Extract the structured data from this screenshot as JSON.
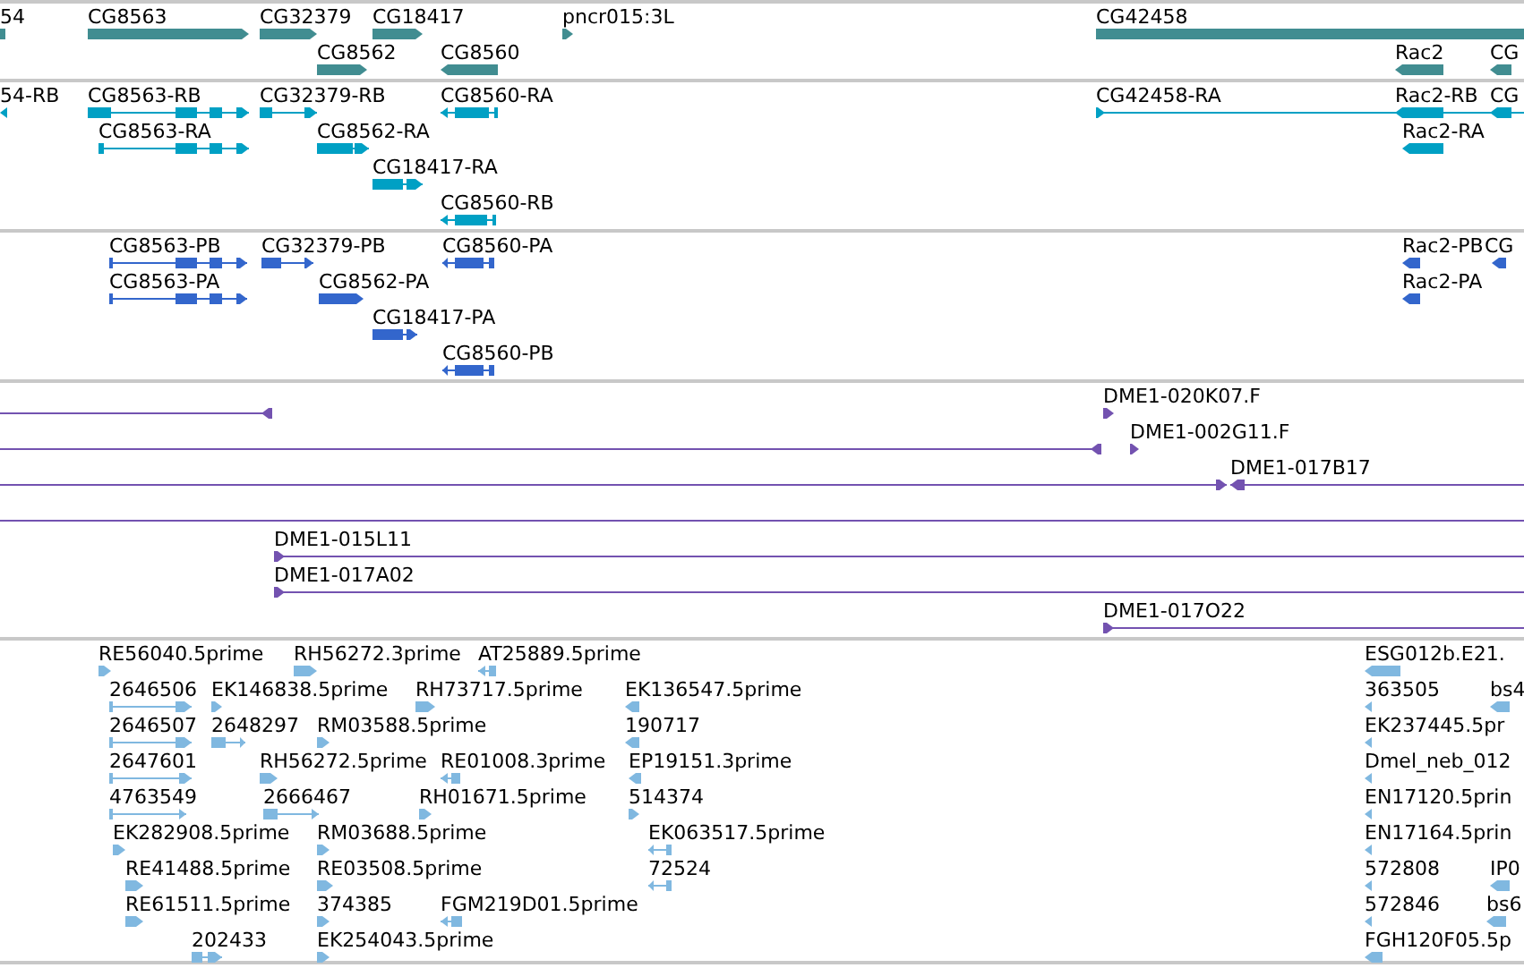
{
  "tracks": [
    {
      "kind": "genes",
      "features": [
        {
          "label": "54",
          "headless": true
        },
        {
          "label": "CG8563",
          "reverse": false
        },
        {
          "label": "CG32379",
          "reverse": false
        },
        {
          "label": "CG18417",
          "reverse": false
        },
        {
          "label": "pncr015:3L",
          "reverse": false
        },
        {
          "label": "CG42458",
          "headless": true
        },
        {
          "label": "CG8562",
          "reverse": false
        },
        {
          "label": "CG8560",
          "reverse": true
        },
        {
          "label": "Rac2",
          "reverse": true
        },
        {
          "label": "CG",
          "reverse": true
        }
      ]
    },
    {
      "kind": "transcripts",
      "features": [
        {
          "label": "54-RB",
          "reverse": true
        },
        {
          "label": "CG8563-RB",
          "reverse": false
        },
        {
          "label": "CG32379-RB",
          "reverse": false
        },
        {
          "label": "CG8560-RA",
          "reverse": true
        },
        {
          "label": "CG42458-RA",
          "reverse": false
        },
        {
          "label": "Rac2-RB",
          "reverse": true
        },
        {
          "label": "CG",
          "reverse": true
        },
        {
          "label": "CG8563-RA",
          "reverse": false
        },
        {
          "label": "CG8562-RA",
          "reverse": false
        },
        {
          "label": "Rac2-RA",
          "reverse": true
        },
        {
          "label": "CG18417-RA",
          "reverse": false
        },
        {
          "label": "CG8560-RB",
          "reverse": true
        }
      ]
    },
    {
      "kind": "proteins",
      "features": [
        {
          "label": "CG8563-PB",
          "reverse": false
        },
        {
          "label": "CG32379-PB",
          "reverse": false
        },
        {
          "label": "CG8560-PA",
          "reverse": true
        },
        {
          "label": "Rac2-PB",
          "reverse": true
        },
        {
          "label": "CG",
          "reverse": true
        },
        {
          "label": "CG8563-PA",
          "reverse": false
        },
        {
          "label": "CG8562-PA",
          "reverse": false
        },
        {
          "label": "Rac2-PA",
          "reverse": true
        },
        {
          "label": "CG18417-PA",
          "reverse": false
        },
        {
          "label": "CG8560-PB",
          "reverse": true
        }
      ]
    },
    {
      "kind": "clones",
      "features": [
        {
          "reverse": true
        },
        {
          "label": "DME1-020K07.F",
          "reverse": false
        },
        {
          "reverse": true
        },
        {
          "label": "DME1-002G11.F",
          "reverse": false
        },
        {
          "reverse": false
        },
        {
          "label": "DME1-017B17",
          "reverse": true
        },
        {
          "headless": true
        },
        {
          "label": "DME1-015L11",
          "reverse": false
        },
        {
          "label": "DME1-017A02",
          "reverse": false
        },
        {
          "label": "DME1-017O22",
          "reverse": false
        }
      ]
    },
    {
      "kind": "ests",
      "features": [
        {
          "label": "RE56040.5prime",
          "reverse": false
        },
        {
          "label": "RH56272.3prime",
          "reverse": false
        },
        {
          "label": "AT25889.5prime",
          "reverse": true
        },
        {
          "label": "ESG012b.E21.",
          "reverse": true
        },
        {
          "label": "2646506",
          "reverse": false
        },
        {
          "label": "EK146838.5prime",
          "reverse": false
        },
        {
          "label": "RH73717.5prime",
          "reverse": false
        },
        {
          "label": "EK136547.5prime",
          "reverse": true
        },
        {
          "label": "363505",
          "reverse": true
        },
        {
          "label": "bs4",
          "reverse": true
        },
        {
          "label": "2646507",
          "reverse": false
        },
        {
          "label": "2648297",
          "reverse": false
        },
        {
          "label": "RM03588.5prime",
          "reverse": false
        },
        {
          "label": "190717",
          "reverse": true
        },
        {
          "label": "EK237445.5pr",
          "reverse": true
        },
        {
          "label": "2647601",
          "reverse": false
        },
        {
          "label": "RH56272.5prime",
          "reverse": false
        },
        {
          "label": "RE01008.3prime",
          "reverse": true
        },
        {
          "label": "EP19151.3prime",
          "reverse": true
        },
        {
          "label": "Dmel_neb_012",
          "reverse": true
        },
        {
          "label": "4763549",
          "reverse": false
        },
        {
          "label": "2666467",
          "reverse": false
        },
        {
          "label": "RH01671.5prime",
          "reverse": false
        },
        {
          "label": "514374",
          "reverse": false
        },
        {
          "label": "EN17120.5prin",
          "reverse": true
        },
        {
          "label": "EK282908.5prime",
          "reverse": false
        },
        {
          "label": "RM03688.5prime",
          "reverse": false
        },
        {
          "label": "EK063517.5prime",
          "reverse": true
        },
        {
          "label": "EN17164.5prin",
          "reverse": true
        },
        {
          "label": "RE41488.5prime",
          "reverse": false
        },
        {
          "label": "RE03508.5prime",
          "reverse": false
        },
        {
          "label": "72524",
          "reverse": true
        },
        {
          "label": "572808",
          "reverse": true
        },
        {
          "label": "IP0",
          "reverse": true
        },
        {
          "label": "RE61511.5prime",
          "reverse": false
        },
        {
          "label": "374385",
          "reverse": false
        },
        {
          "label": "FGM219D01.5prime",
          "reverse": true
        },
        {
          "label": "572846",
          "reverse": true
        },
        {
          "label": "bs6",
          "reverse": true
        },
        {
          "label": "202433",
          "reverse": false
        },
        {
          "label": "EK254043.5prime",
          "reverse": false
        },
        {
          "label": "FGH120F05.5p",
          "reverse": true
        }
      ]
    }
  ]
}
